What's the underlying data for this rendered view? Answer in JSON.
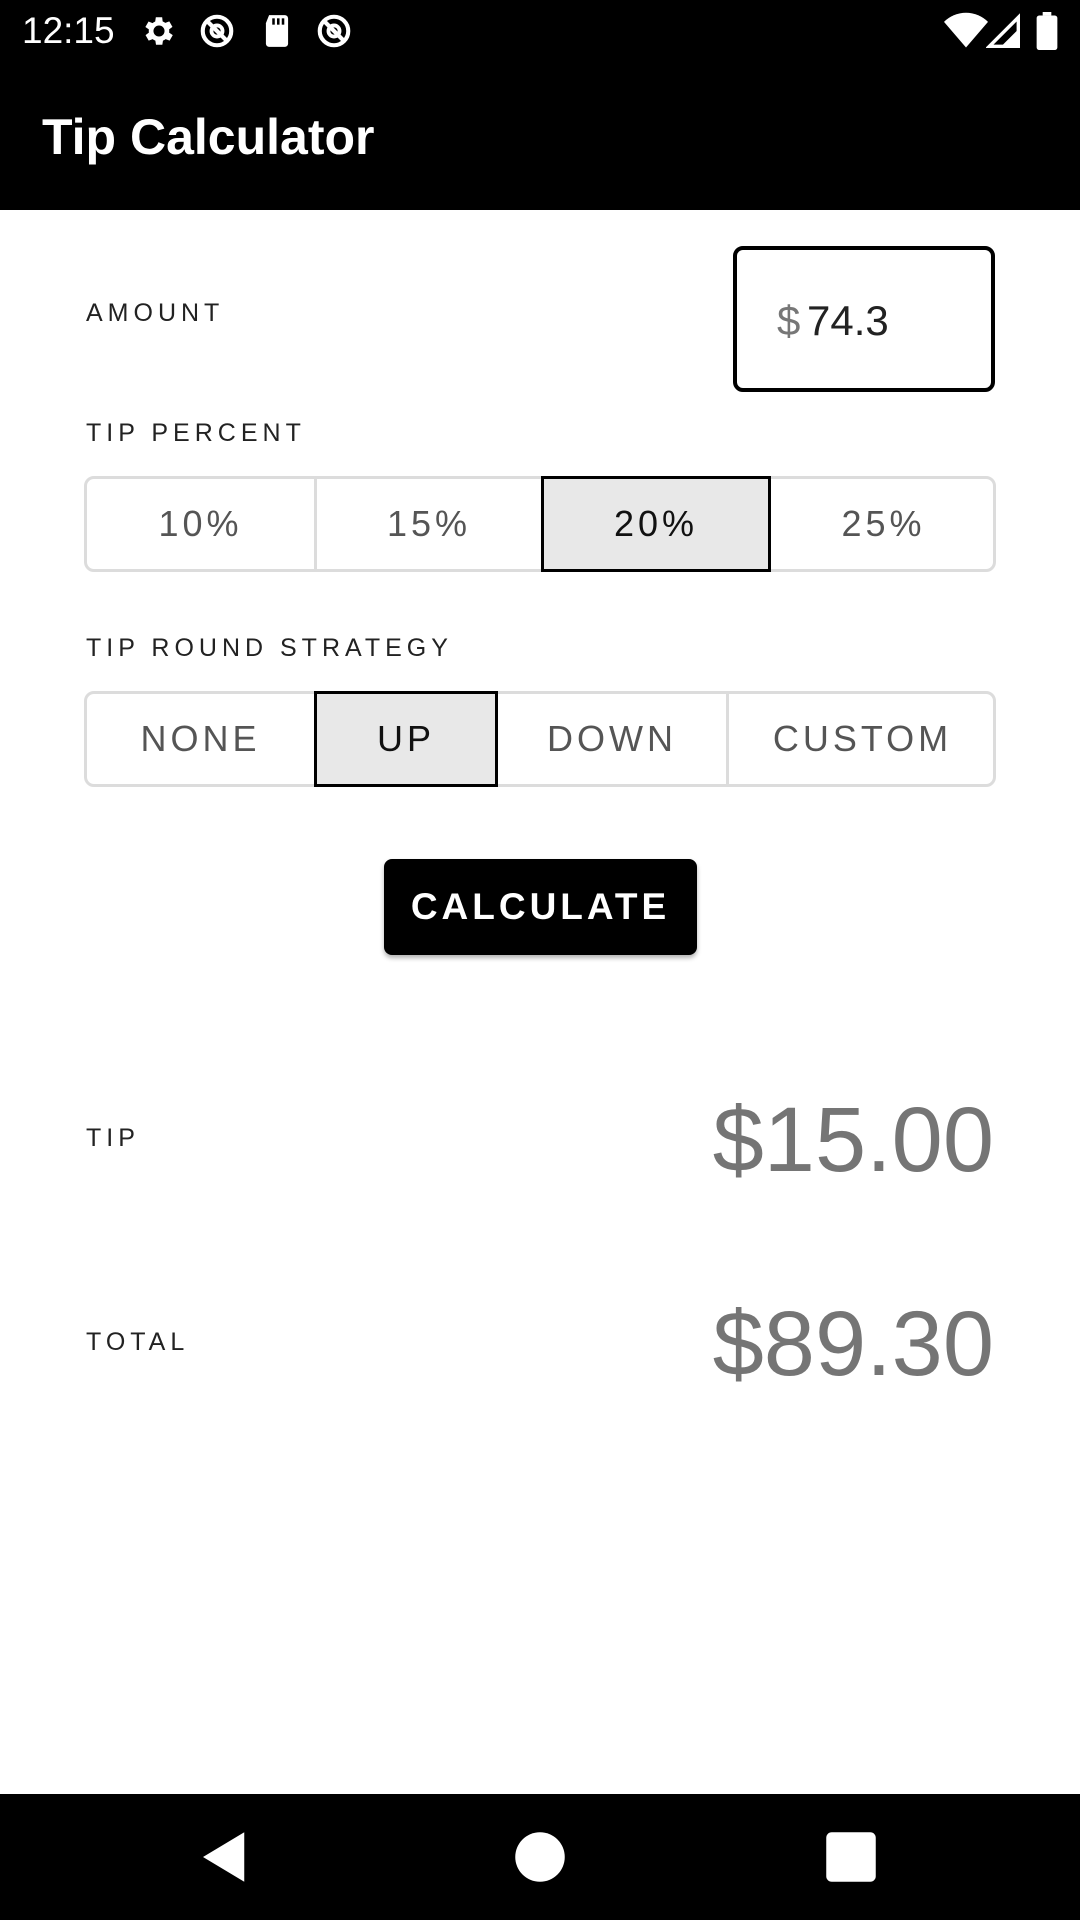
{
  "status_bar": {
    "time": "12:15",
    "left_icons": [
      "gear-icon",
      "no-sim-icon",
      "sd-card-icon",
      "no-sim-icon"
    ],
    "right_icons": [
      "wifi-icon",
      "cell-signal-icon",
      "battery-icon"
    ]
  },
  "app_bar": {
    "title": "Tip Calculator"
  },
  "amount": {
    "label": "AMOUNT",
    "prefix": "$",
    "value": "74.3"
  },
  "tip_percent": {
    "label": "TIP PERCENT",
    "options": [
      "10%",
      "15%",
      "20%",
      "25%"
    ],
    "selected": "20%"
  },
  "round_strategy": {
    "label": "TIP ROUND STRATEGY",
    "options": [
      "NONE",
      "UP",
      "DOWN",
      "CUSTOM"
    ],
    "selected": "UP"
  },
  "calculate_label": "CALCULATE",
  "results": {
    "tip_label": "TIP",
    "tip_value": "$15.00",
    "total_label": "TOTAL",
    "total_value": "$89.30"
  },
  "colors": {
    "bar_background": "#000000",
    "selected_segment": "#e8e8e8",
    "result_text": "#757575"
  }
}
